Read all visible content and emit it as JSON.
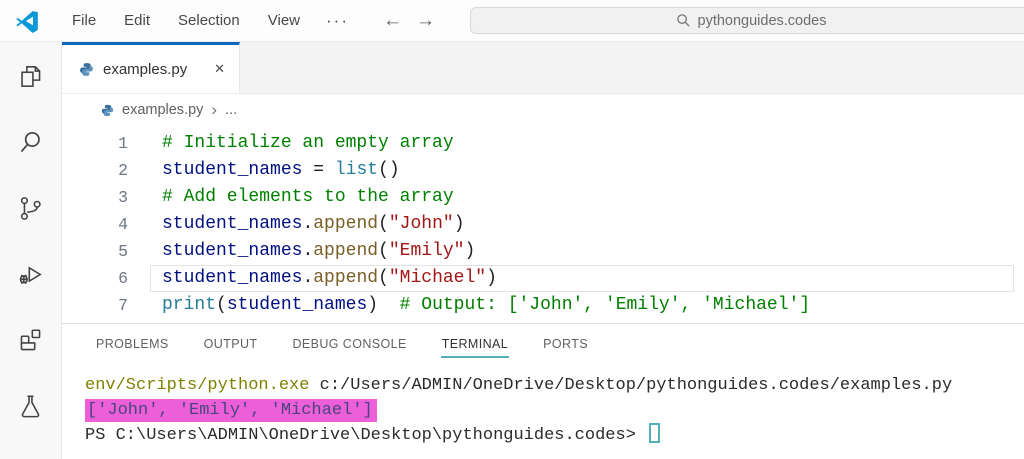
{
  "titlebar": {
    "menu_items": [
      "File",
      "Edit",
      "Selection",
      "View"
    ],
    "more_label": "···",
    "nav": {
      "back": "←",
      "forward": "→"
    },
    "search": {
      "value": "pythonguides.codes"
    }
  },
  "glyphs": {
    "close": "✕",
    "chevron": "›"
  },
  "activity_bar": {
    "items": [
      "explorer",
      "search",
      "source-control",
      "run-and-debug",
      "extensions",
      "testing"
    ]
  },
  "editor": {
    "tab": {
      "label": "examples.py"
    },
    "breadcrumb": {
      "file": "examples.py",
      "more": "..."
    },
    "code_lines": [
      {
        "num": 1,
        "tokens": [
          {
            "text": "# Initialize an empty array",
            "type": "comment"
          }
        ]
      },
      {
        "num": 2,
        "tokens": [
          {
            "text": "student_names",
            "type": "variable"
          },
          {
            "text": " = ",
            "type": "plain"
          },
          {
            "text": "list",
            "type": "builtin"
          },
          {
            "text": "()",
            "type": "plain"
          }
        ]
      },
      {
        "num": 3,
        "tokens": [
          {
            "text": "# Add elements to the array",
            "type": "comment"
          }
        ]
      },
      {
        "num": 4,
        "tokens": [
          {
            "text": "student_names",
            "type": "variable"
          },
          {
            "text": ".",
            "type": "plain"
          },
          {
            "text": "append",
            "type": "function"
          },
          {
            "text": "(",
            "type": "plain"
          },
          {
            "text": "\"John\"",
            "type": "string"
          },
          {
            "text": ")",
            "type": "plain"
          }
        ]
      },
      {
        "num": 5,
        "tokens": [
          {
            "text": "student_names",
            "type": "variable"
          },
          {
            "text": ".",
            "type": "plain"
          },
          {
            "text": "append",
            "type": "function"
          },
          {
            "text": "(",
            "type": "plain"
          },
          {
            "text": "\"Emily\"",
            "type": "string"
          },
          {
            "text": ")",
            "type": "plain"
          }
        ]
      },
      {
        "num": 6,
        "current": true,
        "tokens": [
          {
            "text": "student_names",
            "type": "variable"
          },
          {
            "text": ".",
            "type": "plain"
          },
          {
            "text": "append",
            "type": "function"
          },
          {
            "text": "(",
            "type": "plain"
          },
          {
            "text": "\"Michael\"",
            "type": "string"
          },
          {
            "text": ")",
            "type": "plain"
          }
        ]
      },
      {
        "num": 7,
        "tokens": [
          {
            "text": "print",
            "type": "builtin"
          },
          {
            "text": "(",
            "type": "plain"
          },
          {
            "text": "student_names",
            "type": "variable"
          },
          {
            "text": ")  ",
            "type": "plain"
          },
          {
            "text": "# Output: ['John', 'Emily', 'Michael']",
            "type": "comment"
          }
        ]
      }
    ]
  },
  "panel": {
    "tabs": [
      {
        "label": "PROBLEMS",
        "active": false
      },
      {
        "label": "OUTPUT",
        "active": false
      },
      {
        "label": "DEBUG CONSOLE",
        "active": false
      },
      {
        "label": "TERMINAL",
        "active": true
      },
      {
        "label": "PORTS",
        "active": false
      }
    ],
    "terminal": {
      "lines": [
        {
          "segments": [
            {
              "text": "env/Scripts/python.exe",
              "type": "command"
            },
            {
              "text": " c:/Users/ADMIN/OneDrive/Desktop/pythonguides.codes/examples.py",
              "type": "plain"
            }
          ]
        },
        {
          "segments": [
            {
              "text": "['John', 'Emily', 'Michael']",
              "type": "highlight"
            }
          ]
        },
        {
          "segments": [
            {
              "text": "PS C:\\Users\\ADMIN\\OneDrive\\Desktop\\pythonguides.codes> ",
              "type": "plain"
            },
            {
              "text": "",
              "type": "cursor"
            }
          ]
        }
      ]
    }
  },
  "colors": {
    "accent-blue": "#0a99d6",
    "tab-active-border": "#1068bf",
    "comment": "#008000",
    "variable": "#001080",
    "builtin": "#267f99",
    "func": "#795E26",
    "string": "#a31515",
    "plain": "#1f1f1f",
    "line-num": "#6e7681",
    "term-command": "#7f8000",
    "term-text": "#2b2b2b",
    "highlight-bg": "#ec5fd8",
    "highlight-fg": "#46467e",
    "cursor": "#50aebd",
    "panel-underline": "#51aebd"
  }
}
